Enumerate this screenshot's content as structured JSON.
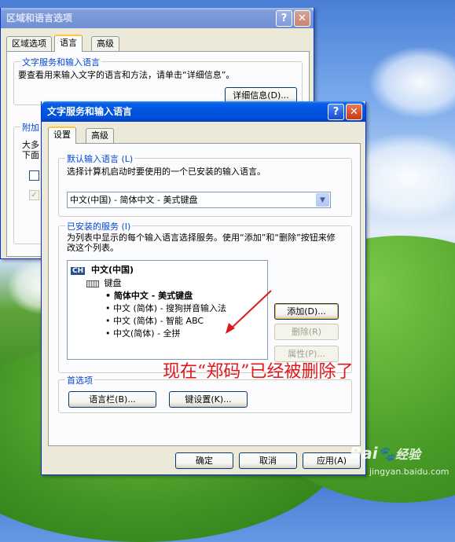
{
  "bg_dialog": {
    "title": "区域和语言选项",
    "tabs": [
      "区域选项",
      "语言",
      "高级"
    ],
    "group_text_services": {
      "label": "文字服务和输入语言",
      "desc": "要查看用来输入文字的语言和方法，请单击“详细信息”。",
      "details_button": "详细信息(D)..."
    },
    "group_supplement": {
      "label_partial": "附加",
      "line1_partial": "大多",
      "line2_partial": "下面"
    }
  },
  "fg_dialog": {
    "title": "文字服务和输入语言",
    "tabs": [
      "设置",
      "高级"
    ],
    "default_lang": {
      "label": "默认输入语言 (L)",
      "desc": "选择计算机启动时要使用的一个已安装的输入语言。",
      "selected": "中文(中国) - 简体中文 - 美式键盘"
    },
    "installed": {
      "label": "已安装的服务 (I)",
      "desc": "为列表中显示的每个输入语言选择服务。使用“添加”和“删除”按钮来修改这个列表。",
      "lang_badge": "CH",
      "lang_name": "中文(中国)",
      "category": "键盘",
      "services": [
        "简体中文 - 美式键盘",
        "中文 (简体) - 搜狗拼音输入法",
        "中文 (简体) - 智能 ABC",
        "中文(简体) - 全拼"
      ],
      "add_button": "添加(D)...",
      "remove_button": "删除(R)",
      "props_button": "属性(P)..."
    },
    "prefs": {
      "label": "首选项",
      "langbar_button": "语言栏(B)...",
      "keysettings_button": "键设置(K)..."
    },
    "footer": {
      "ok": "确定",
      "cancel": "取消",
      "apply": "应用(A)"
    }
  },
  "annotation": "现在“郑码”已经被删除了",
  "watermark": {
    "brand": "Bai",
    "paw": "🐾",
    "brand2": "经验",
    "url": "jingyan.baidu.com"
  }
}
